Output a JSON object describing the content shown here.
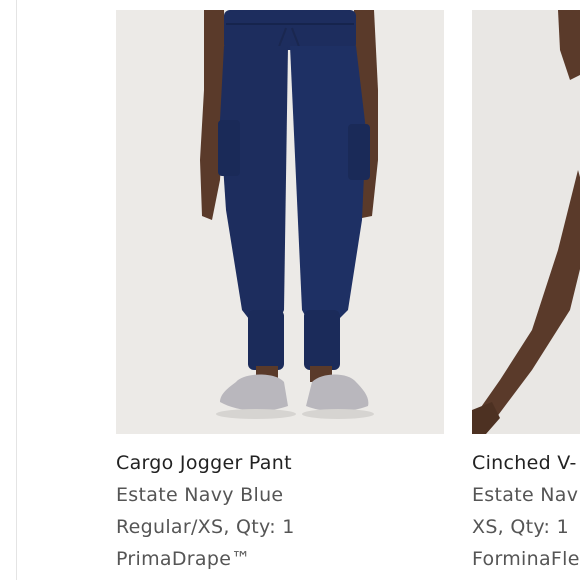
{
  "products": [
    {
      "name": "Cargo Jogger Pant",
      "color": "Estate Navy Blue",
      "size_qty": "Regular/XS, Qty: 1",
      "fabric": "PrimaDrape™",
      "image_icon": "navy-jogger-pant-photo"
    },
    {
      "name": "Cinched V-",
      "color": "Estate Nav",
      "size_qty": "XS, Qty: 1",
      "fabric": "ForminaFle",
      "image_icon": "navy-top-photo"
    }
  ],
  "colors": {
    "navy": "#1d2d5e",
    "background": "#eceae7",
    "skin": "#5a3a2a",
    "shoe": "#b9b7bd"
  }
}
